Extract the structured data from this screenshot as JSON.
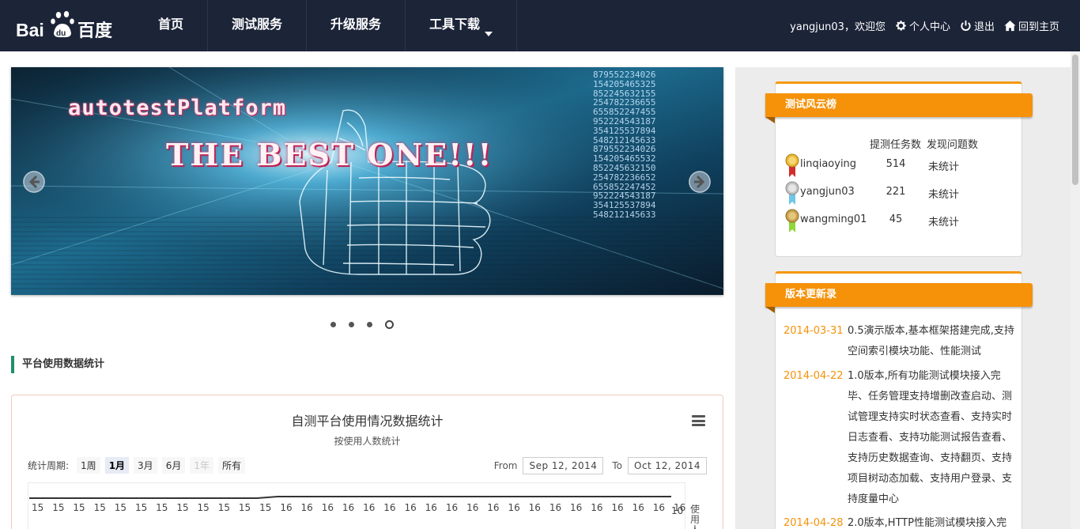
{
  "header": {
    "logo_text": "Baidu百度",
    "nav": [
      {
        "label": "首页"
      },
      {
        "label": "测试服务"
      },
      {
        "label": "升级服务"
      },
      {
        "label": "工具下载"
      }
    ],
    "welcome": "yangjun03，欢迎您",
    "personal_center": "个人中心",
    "logout": "退出",
    "home": "回到主页"
  },
  "carousel": {
    "title_line1": "autotestPlatform",
    "title_line2": "THE BEST ONE!!!",
    "numbers": "879552234026\n154205465325\n852245632155\n254782236655\n655852247455\n952224543187\n354125537894\n548212145633\n879552234026\n154205465532\n852245632150\n254782236652\n655852247452\n952224543187\n354125537894\n548212145633",
    "slide_count": 4,
    "active_slide": 4
  },
  "stats_section": {
    "title": "平台使用数据统计"
  },
  "chart": {
    "title": "自测平台使用情况数据统计",
    "subtitle": "按使用人数统计",
    "range_label": "统计周期:",
    "ranges": [
      {
        "label": "1周",
        "state": "normal"
      },
      {
        "label": "1月",
        "state": "selected"
      },
      {
        "label": "3月",
        "state": "normal"
      },
      {
        "label": "6月",
        "state": "normal"
      },
      {
        "label": "1年",
        "state": "disabled"
      },
      {
        "label": "所有",
        "state": "normal"
      }
    ],
    "from_label": "From",
    "from_value": "Sep 12, 2014",
    "to_label": "To",
    "to_value": "Oct 12, 2014",
    "ylabel_visible": "使用人"
  },
  "chart_data": {
    "type": "line",
    "title": "自测平台使用情况数据统计",
    "subtitle": "按使用人数统计",
    "ylabel": "使用人",
    "data_labels": [
      "15",
      "15",
      "15",
      "15",
      "15",
      "15",
      "15",
      "15",
      "15",
      "15",
      "15",
      "15",
      "16",
      "16",
      "16",
      "16",
      "16",
      "16",
      "16",
      "16",
      "16",
      "16",
      "16",
      "16",
      "16",
      "16",
      "16",
      "16",
      "16",
      "16",
      "16",
      "16"
    ],
    "values": [
      15,
      15,
      15,
      15,
      15,
      15,
      15,
      15,
      15,
      15,
      15,
      15,
      16,
      16,
      16,
      16,
      16,
      16,
      16,
      16,
      16,
      16,
      16,
      16,
      16,
      16,
      16,
      16,
      16,
      16,
      16,
      16
    ],
    "last_label": "10",
    "grid": true
  },
  "leaderboard": {
    "title": "测试风云榜",
    "col_tasks": "提测任务数",
    "col_issues": "发现问题数",
    "rows": [
      {
        "name": "linqiaoying",
        "tasks": "514",
        "issues": "未统计",
        "medal": "gold"
      },
      {
        "name": "yangjun03",
        "tasks": "221",
        "issues": "未统计",
        "medal": "silver"
      },
      {
        "name": "wangming01",
        "tasks": "45",
        "issues": "未统计",
        "medal": "bronze"
      }
    ],
    "medal_colors": {
      "gold": "#e8b93a",
      "silver": "#c5c5c5",
      "bronze": "#c9a24e"
    },
    "ribbon_colors": {
      "gold": "#d42b2b",
      "silver": "#6ec6e8",
      "bronze": "#8fd63a"
    }
  },
  "changelog": {
    "title": "版本更新录",
    "items": [
      {
        "date": "2014-03-31",
        "text": "0.5演示版本,基本框架搭建完成,支持空间索引模块功能、性能测试"
      },
      {
        "date": "2014-04-22",
        "text": "1.0版本,所有功能测试模块接入完毕、任务管理支持增删改查启动、测试管理支持实时状态查看、支持实时日志查看、支持功能测试报告查看、支持历史数据查询、支持翻页、支持项目树动态加载、支持用户登录、支持度量中心"
      },
      {
        "date": "2014-04-28",
        "text": "2.0版本,HTTP性能测试模块接入完"
      }
    ]
  },
  "colors": {
    "header_bg": "#1c2438",
    "accent_orange": "#f5920a",
    "section_green": "#1e8f6a"
  }
}
